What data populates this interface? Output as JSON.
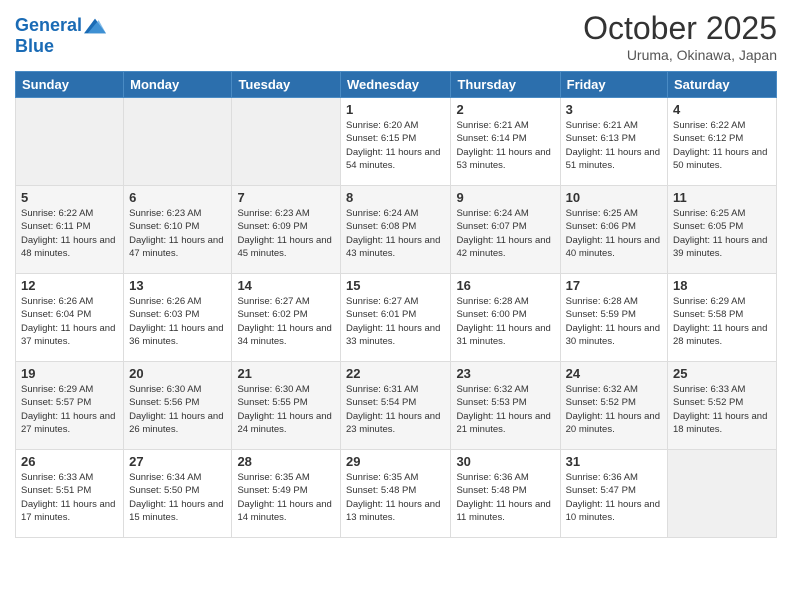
{
  "logo": {
    "line1": "General",
    "line2": "Blue"
  },
  "title": "October 2025",
  "subtitle": "Uruma, Okinawa, Japan",
  "days_of_week": [
    "Sunday",
    "Monday",
    "Tuesday",
    "Wednesday",
    "Thursday",
    "Friday",
    "Saturday"
  ],
  "weeks": [
    [
      {
        "day": "",
        "sunrise": "",
        "sunset": "",
        "daylight": ""
      },
      {
        "day": "",
        "sunrise": "",
        "sunset": "",
        "daylight": ""
      },
      {
        "day": "",
        "sunrise": "",
        "sunset": "",
        "daylight": ""
      },
      {
        "day": "1",
        "sunrise": "Sunrise: 6:20 AM",
        "sunset": "Sunset: 6:15 PM",
        "daylight": "Daylight: 11 hours and 54 minutes."
      },
      {
        "day": "2",
        "sunrise": "Sunrise: 6:21 AM",
        "sunset": "Sunset: 6:14 PM",
        "daylight": "Daylight: 11 hours and 53 minutes."
      },
      {
        "day": "3",
        "sunrise": "Sunrise: 6:21 AM",
        "sunset": "Sunset: 6:13 PM",
        "daylight": "Daylight: 11 hours and 51 minutes."
      },
      {
        "day": "4",
        "sunrise": "Sunrise: 6:22 AM",
        "sunset": "Sunset: 6:12 PM",
        "daylight": "Daylight: 11 hours and 50 minutes."
      }
    ],
    [
      {
        "day": "5",
        "sunrise": "Sunrise: 6:22 AM",
        "sunset": "Sunset: 6:11 PM",
        "daylight": "Daylight: 11 hours and 48 minutes."
      },
      {
        "day": "6",
        "sunrise": "Sunrise: 6:23 AM",
        "sunset": "Sunset: 6:10 PM",
        "daylight": "Daylight: 11 hours and 47 minutes."
      },
      {
        "day": "7",
        "sunrise": "Sunrise: 6:23 AM",
        "sunset": "Sunset: 6:09 PM",
        "daylight": "Daylight: 11 hours and 45 minutes."
      },
      {
        "day": "8",
        "sunrise": "Sunrise: 6:24 AM",
        "sunset": "Sunset: 6:08 PM",
        "daylight": "Daylight: 11 hours and 43 minutes."
      },
      {
        "day": "9",
        "sunrise": "Sunrise: 6:24 AM",
        "sunset": "Sunset: 6:07 PM",
        "daylight": "Daylight: 11 hours and 42 minutes."
      },
      {
        "day": "10",
        "sunrise": "Sunrise: 6:25 AM",
        "sunset": "Sunset: 6:06 PM",
        "daylight": "Daylight: 11 hours and 40 minutes."
      },
      {
        "day": "11",
        "sunrise": "Sunrise: 6:25 AM",
        "sunset": "Sunset: 6:05 PM",
        "daylight": "Daylight: 11 hours and 39 minutes."
      }
    ],
    [
      {
        "day": "12",
        "sunrise": "Sunrise: 6:26 AM",
        "sunset": "Sunset: 6:04 PM",
        "daylight": "Daylight: 11 hours and 37 minutes."
      },
      {
        "day": "13",
        "sunrise": "Sunrise: 6:26 AM",
        "sunset": "Sunset: 6:03 PM",
        "daylight": "Daylight: 11 hours and 36 minutes."
      },
      {
        "day": "14",
        "sunrise": "Sunrise: 6:27 AM",
        "sunset": "Sunset: 6:02 PM",
        "daylight": "Daylight: 11 hours and 34 minutes."
      },
      {
        "day": "15",
        "sunrise": "Sunrise: 6:27 AM",
        "sunset": "Sunset: 6:01 PM",
        "daylight": "Daylight: 11 hours and 33 minutes."
      },
      {
        "day": "16",
        "sunrise": "Sunrise: 6:28 AM",
        "sunset": "Sunset: 6:00 PM",
        "daylight": "Daylight: 11 hours and 31 minutes."
      },
      {
        "day": "17",
        "sunrise": "Sunrise: 6:28 AM",
        "sunset": "Sunset: 5:59 PM",
        "daylight": "Daylight: 11 hours and 30 minutes."
      },
      {
        "day": "18",
        "sunrise": "Sunrise: 6:29 AM",
        "sunset": "Sunset: 5:58 PM",
        "daylight": "Daylight: 11 hours and 28 minutes."
      }
    ],
    [
      {
        "day": "19",
        "sunrise": "Sunrise: 6:29 AM",
        "sunset": "Sunset: 5:57 PM",
        "daylight": "Daylight: 11 hours and 27 minutes."
      },
      {
        "day": "20",
        "sunrise": "Sunrise: 6:30 AM",
        "sunset": "Sunset: 5:56 PM",
        "daylight": "Daylight: 11 hours and 26 minutes."
      },
      {
        "day": "21",
        "sunrise": "Sunrise: 6:30 AM",
        "sunset": "Sunset: 5:55 PM",
        "daylight": "Daylight: 11 hours and 24 minutes."
      },
      {
        "day": "22",
        "sunrise": "Sunrise: 6:31 AM",
        "sunset": "Sunset: 5:54 PM",
        "daylight": "Daylight: 11 hours and 23 minutes."
      },
      {
        "day": "23",
        "sunrise": "Sunrise: 6:32 AM",
        "sunset": "Sunset: 5:53 PM",
        "daylight": "Daylight: 11 hours and 21 minutes."
      },
      {
        "day": "24",
        "sunrise": "Sunrise: 6:32 AM",
        "sunset": "Sunset: 5:52 PM",
        "daylight": "Daylight: 11 hours and 20 minutes."
      },
      {
        "day": "25",
        "sunrise": "Sunrise: 6:33 AM",
        "sunset": "Sunset: 5:52 PM",
        "daylight": "Daylight: 11 hours and 18 minutes."
      }
    ],
    [
      {
        "day": "26",
        "sunrise": "Sunrise: 6:33 AM",
        "sunset": "Sunset: 5:51 PM",
        "daylight": "Daylight: 11 hours and 17 minutes."
      },
      {
        "day": "27",
        "sunrise": "Sunrise: 6:34 AM",
        "sunset": "Sunset: 5:50 PM",
        "daylight": "Daylight: 11 hours and 15 minutes."
      },
      {
        "day": "28",
        "sunrise": "Sunrise: 6:35 AM",
        "sunset": "Sunset: 5:49 PM",
        "daylight": "Daylight: 11 hours and 14 minutes."
      },
      {
        "day": "29",
        "sunrise": "Sunrise: 6:35 AM",
        "sunset": "Sunset: 5:48 PM",
        "daylight": "Daylight: 11 hours and 13 minutes."
      },
      {
        "day": "30",
        "sunrise": "Sunrise: 6:36 AM",
        "sunset": "Sunset: 5:48 PM",
        "daylight": "Daylight: 11 hours and 11 minutes."
      },
      {
        "day": "31",
        "sunrise": "Sunrise: 6:36 AM",
        "sunset": "Sunset: 5:47 PM",
        "daylight": "Daylight: 11 hours and 10 minutes."
      },
      {
        "day": "",
        "sunrise": "",
        "sunset": "",
        "daylight": ""
      }
    ]
  ]
}
